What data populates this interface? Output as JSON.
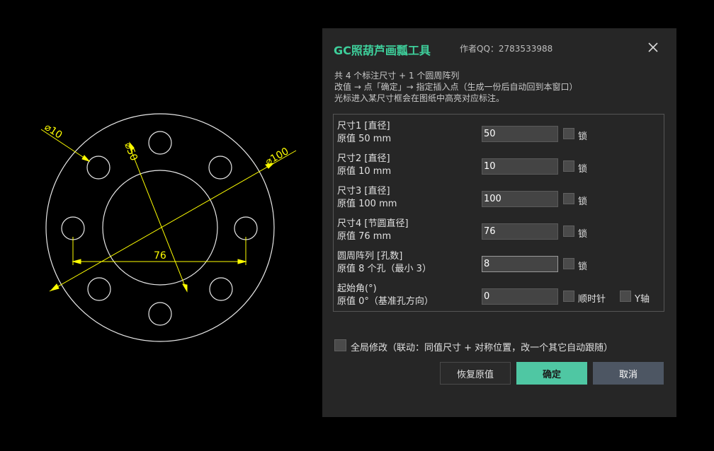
{
  "drawing": {
    "dim_d10": "⌀10",
    "dim_d50": "⌀50",
    "dim_d100": "⌀100",
    "dim_76": "76",
    "line_color": "#e8e8e8",
    "dim_color": "#ffff00"
  },
  "dialog": {
    "title": "GC照葫芦画瓢工具",
    "author": "作者QQ：2783533988",
    "info": [
      "共 4 个标注尺寸 + 1 个圆周阵列",
      "改值 → 点「确定」→ 指定插入点（生成一份后自动回到本窗口）",
      "光标进入某尺寸框会在图纸中高亮对应标注。"
    ],
    "rows": [
      {
        "line1": "尺寸1  [直径]",
        "line2": "原值 50 mm",
        "value": "50",
        "lock": "锁"
      },
      {
        "line1": "尺寸2  [直径]",
        "line2": "原值 10 mm",
        "value": "10",
        "lock": "锁"
      },
      {
        "line1": "尺寸3  [直径]",
        "line2": "原值 100 mm",
        "value": "100",
        "lock": "锁"
      },
      {
        "line1": "尺寸4  [节圆直径]",
        "line2": "原值 76 mm",
        "value": "76",
        "lock": "锁"
      },
      {
        "line1": "圆周阵列  [孔数]",
        "line2": "原值 8 个孔（最小 3）",
        "value": "8",
        "lock": "锁"
      },
      {
        "line1": "起始角(°)",
        "line2": "原值 0°（基准孔方向）",
        "value": "0",
        "clockwise": "顺时针",
        "yaxis": "Y轴"
      }
    ],
    "global_modify": "全局修改（联动：同值尺寸 + 对称位置，改一个其它自动跟随）",
    "buttons": {
      "restore": "恢复原值",
      "ok": "确定",
      "cancel": "取消"
    },
    "colors": {
      "accent": "#3ecf9b",
      "ok_bg": "#4fc7a3",
      "cancel_bg": "#4d5663"
    }
  }
}
